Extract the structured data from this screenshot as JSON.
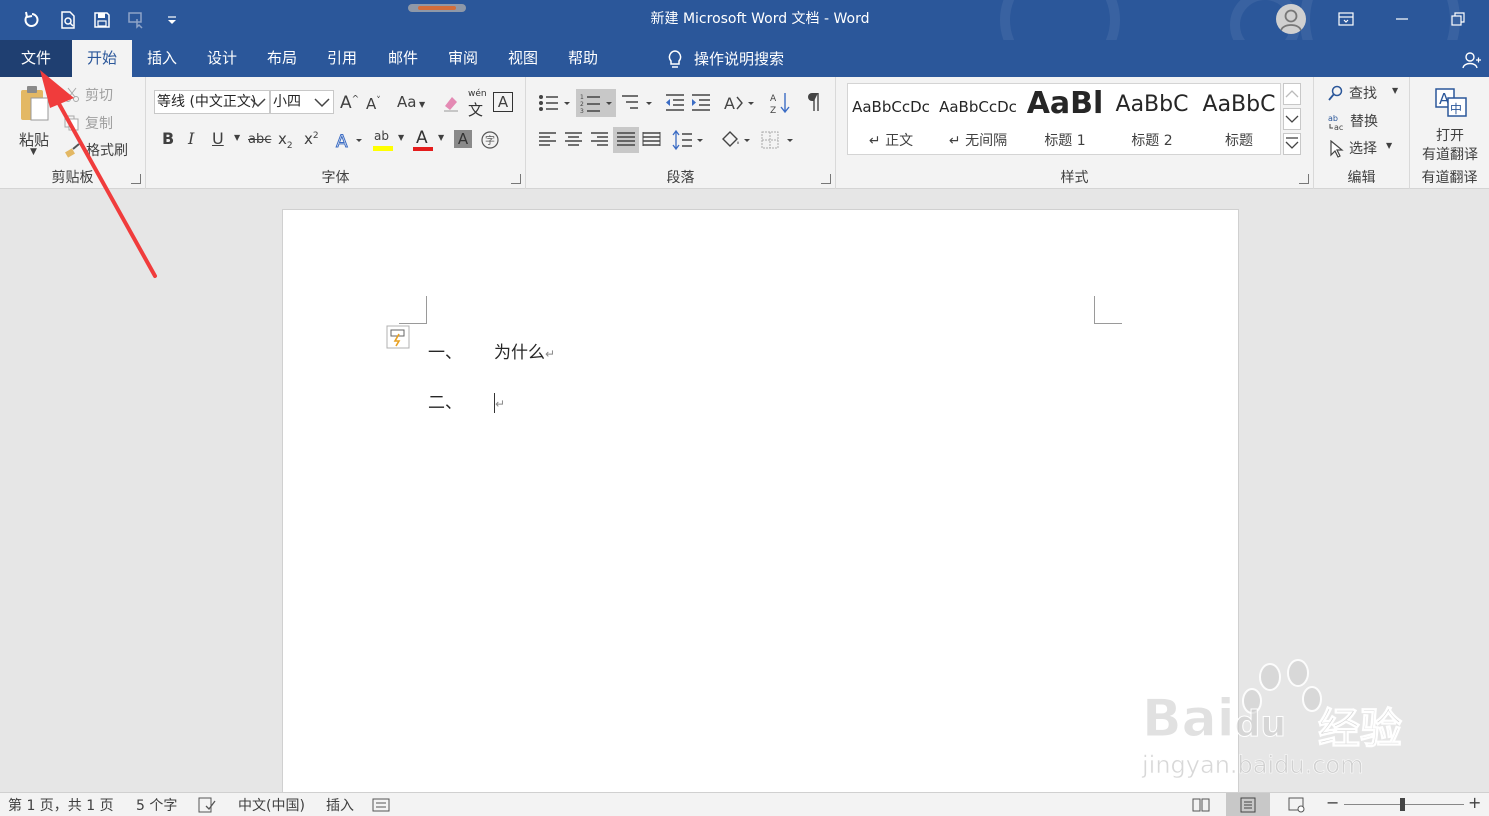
{
  "window": {
    "title": "新建 Microsoft Word 文档  -  Word",
    "qat": [
      "undo-icon",
      "print-preview-icon",
      "save-icon",
      "touch-mode-icon",
      "customize-qat-icon"
    ],
    "controls": [
      "ribbon-display-icon",
      "minimize-icon",
      "restore-icon"
    ]
  },
  "tabs": [
    {
      "label": "文件",
      "id": "file"
    },
    {
      "label": "开始",
      "id": "home",
      "active": true
    },
    {
      "label": "插入",
      "id": "insert"
    },
    {
      "label": "设计",
      "id": "design"
    },
    {
      "label": "布局",
      "id": "layout"
    },
    {
      "label": "引用",
      "id": "references"
    },
    {
      "label": "邮件",
      "id": "mailings"
    },
    {
      "label": "审阅",
      "id": "review"
    },
    {
      "label": "视图",
      "id": "view"
    },
    {
      "label": "帮助",
      "id": "help"
    }
  ],
  "tell_me": "操作说明搜索",
  "ribbon": {
    "clipboard": {
      "label": "剪贴板",
      "paste": "粘贴",
      "cut": "剪切",
      "copy": "复制",
      "format_painter": "格式刷"
    },
    "font": {
      "label": "字体",
      "font_name": "等线 (中文正文)",
      "font_size": "小四",
      "grow": "A",
      "shrink": "A",
      "change_case": "Aa",
      "bold": "B",
      "italic": "I",
      "underline": "U",
      "strike": "abc",
      "subscript": "x",
      "superscript": "x",
      "phonetic": "wén",
      "char_border": "A",
      "highlight": "ab"
    },
    "paragraph": {
      "label": "段落"
    },
    "styles": {
      "label": "样式",
      "items": [
        {
          "preview": "AaBbCcDc",
          "name": "↵ 正文"
        },
        {
          "preview": "AaBbCcDc",
          "name": "↵ 无间隔"
        },
        {
          "preview": "AaBl",
          "name": "标题 1"
        },
        {
          "preview": "AaBbC",
          "name": "标题 2"
        },
        {
          "preview": "AaBbC",
          "name": "标题"
        }
      ]
    },
    "editing": {
      "label": "编辑",
      "find": "查找",
      "replace": "替换",
      "select": "选择"
    },
    "youdao": {
      "label": "有道翻译",
      "button_line1": "打开",
      "button_line2": "有道翻译"
    }
  },
  "document": {
    "lines": [
      {
        "number": "一、",
        "text": "为什么"
      },
      {
        "number": "二、",
        "text": ""
      }
    ],
    "paragraph_mark": "↵"
  },
  "statusbar": {
    "page": "第 1 页，共 1 页",
    "words": "5 个字",
    "language": "中文(中国)",
    "mode": "插入"
  },
  "watermark": {
    "brand": "Bai",
    "brand2": "du",
    "cn": "经验",
    "url": "jingyan.baidu.com"
  },
  "colors": {
    "word_blue": "#2b579a",
    "ribbon_bg": "#f3f3f3",
    "annotation_red": "#f03c3c"
  }
}
